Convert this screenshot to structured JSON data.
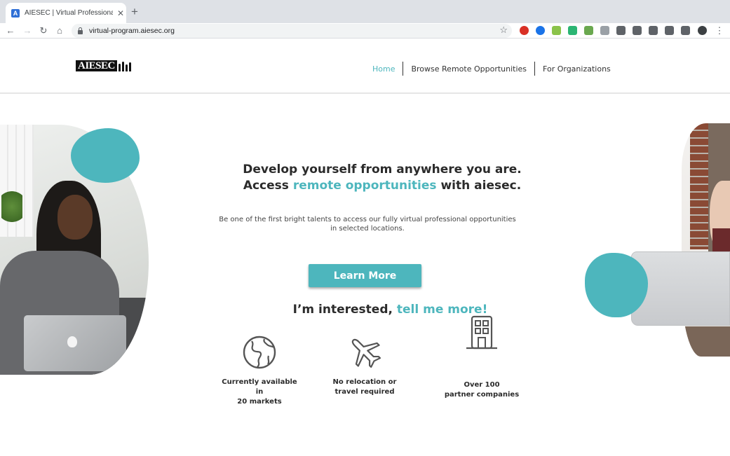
{
  "browser": {
    "tab_title": "AIESEC | Virtual Professional P",
    "favicon_letter": "A",
    "close_glyph": "✕",
    "new_tab_glyph": "+",
    "back_glyph": "←",
    "forward_glyph": "→",
    "reload_glyph": "↻",
    "home_glyph": "⌂",
    "url": "virtual-program.aiesec.org",
    "star_glyph": "☆",
    "menu_glyph": "⋮",
    "extension_colors": [
      "#d93025",
      "#1a73e8",
      "#8bc34a",
      "#2bb573",
      "#6aa84f",
      "#9aa0a6",
      "#5f6368",
      "#5f6368",
      "#5f6368",
      "#5f6368",
      "#5f6368"
    ]
  },
  "site": {
    "logo_text": "AIESEC",
    "nav": {
      "home": "Home",
      "browse": "Browse Remote Opportunities",
      "organizations": "For Organizations"
    },
    "accent_color": "#4db6bd"
  },
  "hero": {
    "headline_line1": "Develop yourself from anywhere you are.",
    "headline_line2_pre": "Access ",
    "headline_line2_accent": "remote opportunities",
    "headline_line2_post": " with aiesec.",
    "subtext_line1": "Be one of the first bright talents to access our fully virtual professional opportunities",
    "subtext_line2": "in selected locations.",
    "learn_more": "Learn More",
    "interested_pre": "I’m interested, ",
    "interested_link": "tell me more!"
  },
  "features": [
    {
      "icon": "globe-icon",
      "line1": "Currently available in",
      "line2": "20 markets"
    },
    {
      "icon": "airplane-icon",
      "line1": "No relocation or",
      "line2": "travel required"
    },
    {
      "icon": "building-icon",
      "line1": "Over 100",
      "line2": "partner companies"
    }
  ]
}
